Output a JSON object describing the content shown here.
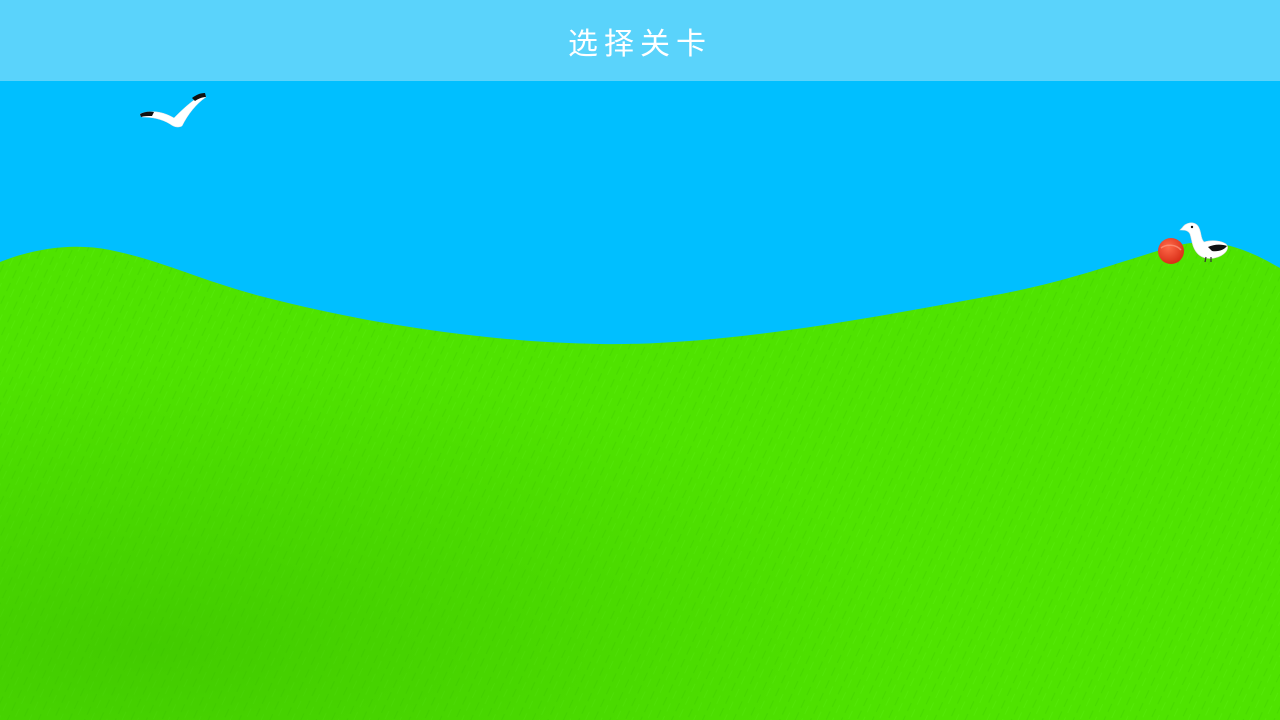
{
  "header": {
    "title": "选择关卡"
  },
  "colors": {
    "sky": "#00bfff",
    "title_bar": "#5ad3fb",
    "title_text": "#ffffff",
    "grass": "#4fe300",
    "grass_dark": "#3fc800",
    "ball": "#e8321e",
    "bird_body": "#ffffff",
    "bird_accent": "#111111"
  },
  "scene": {
    "flying_bird": "seagull-flying",
    "standing_bird": "seagull-standing",
    "ball": "red-ball"
  }
}
